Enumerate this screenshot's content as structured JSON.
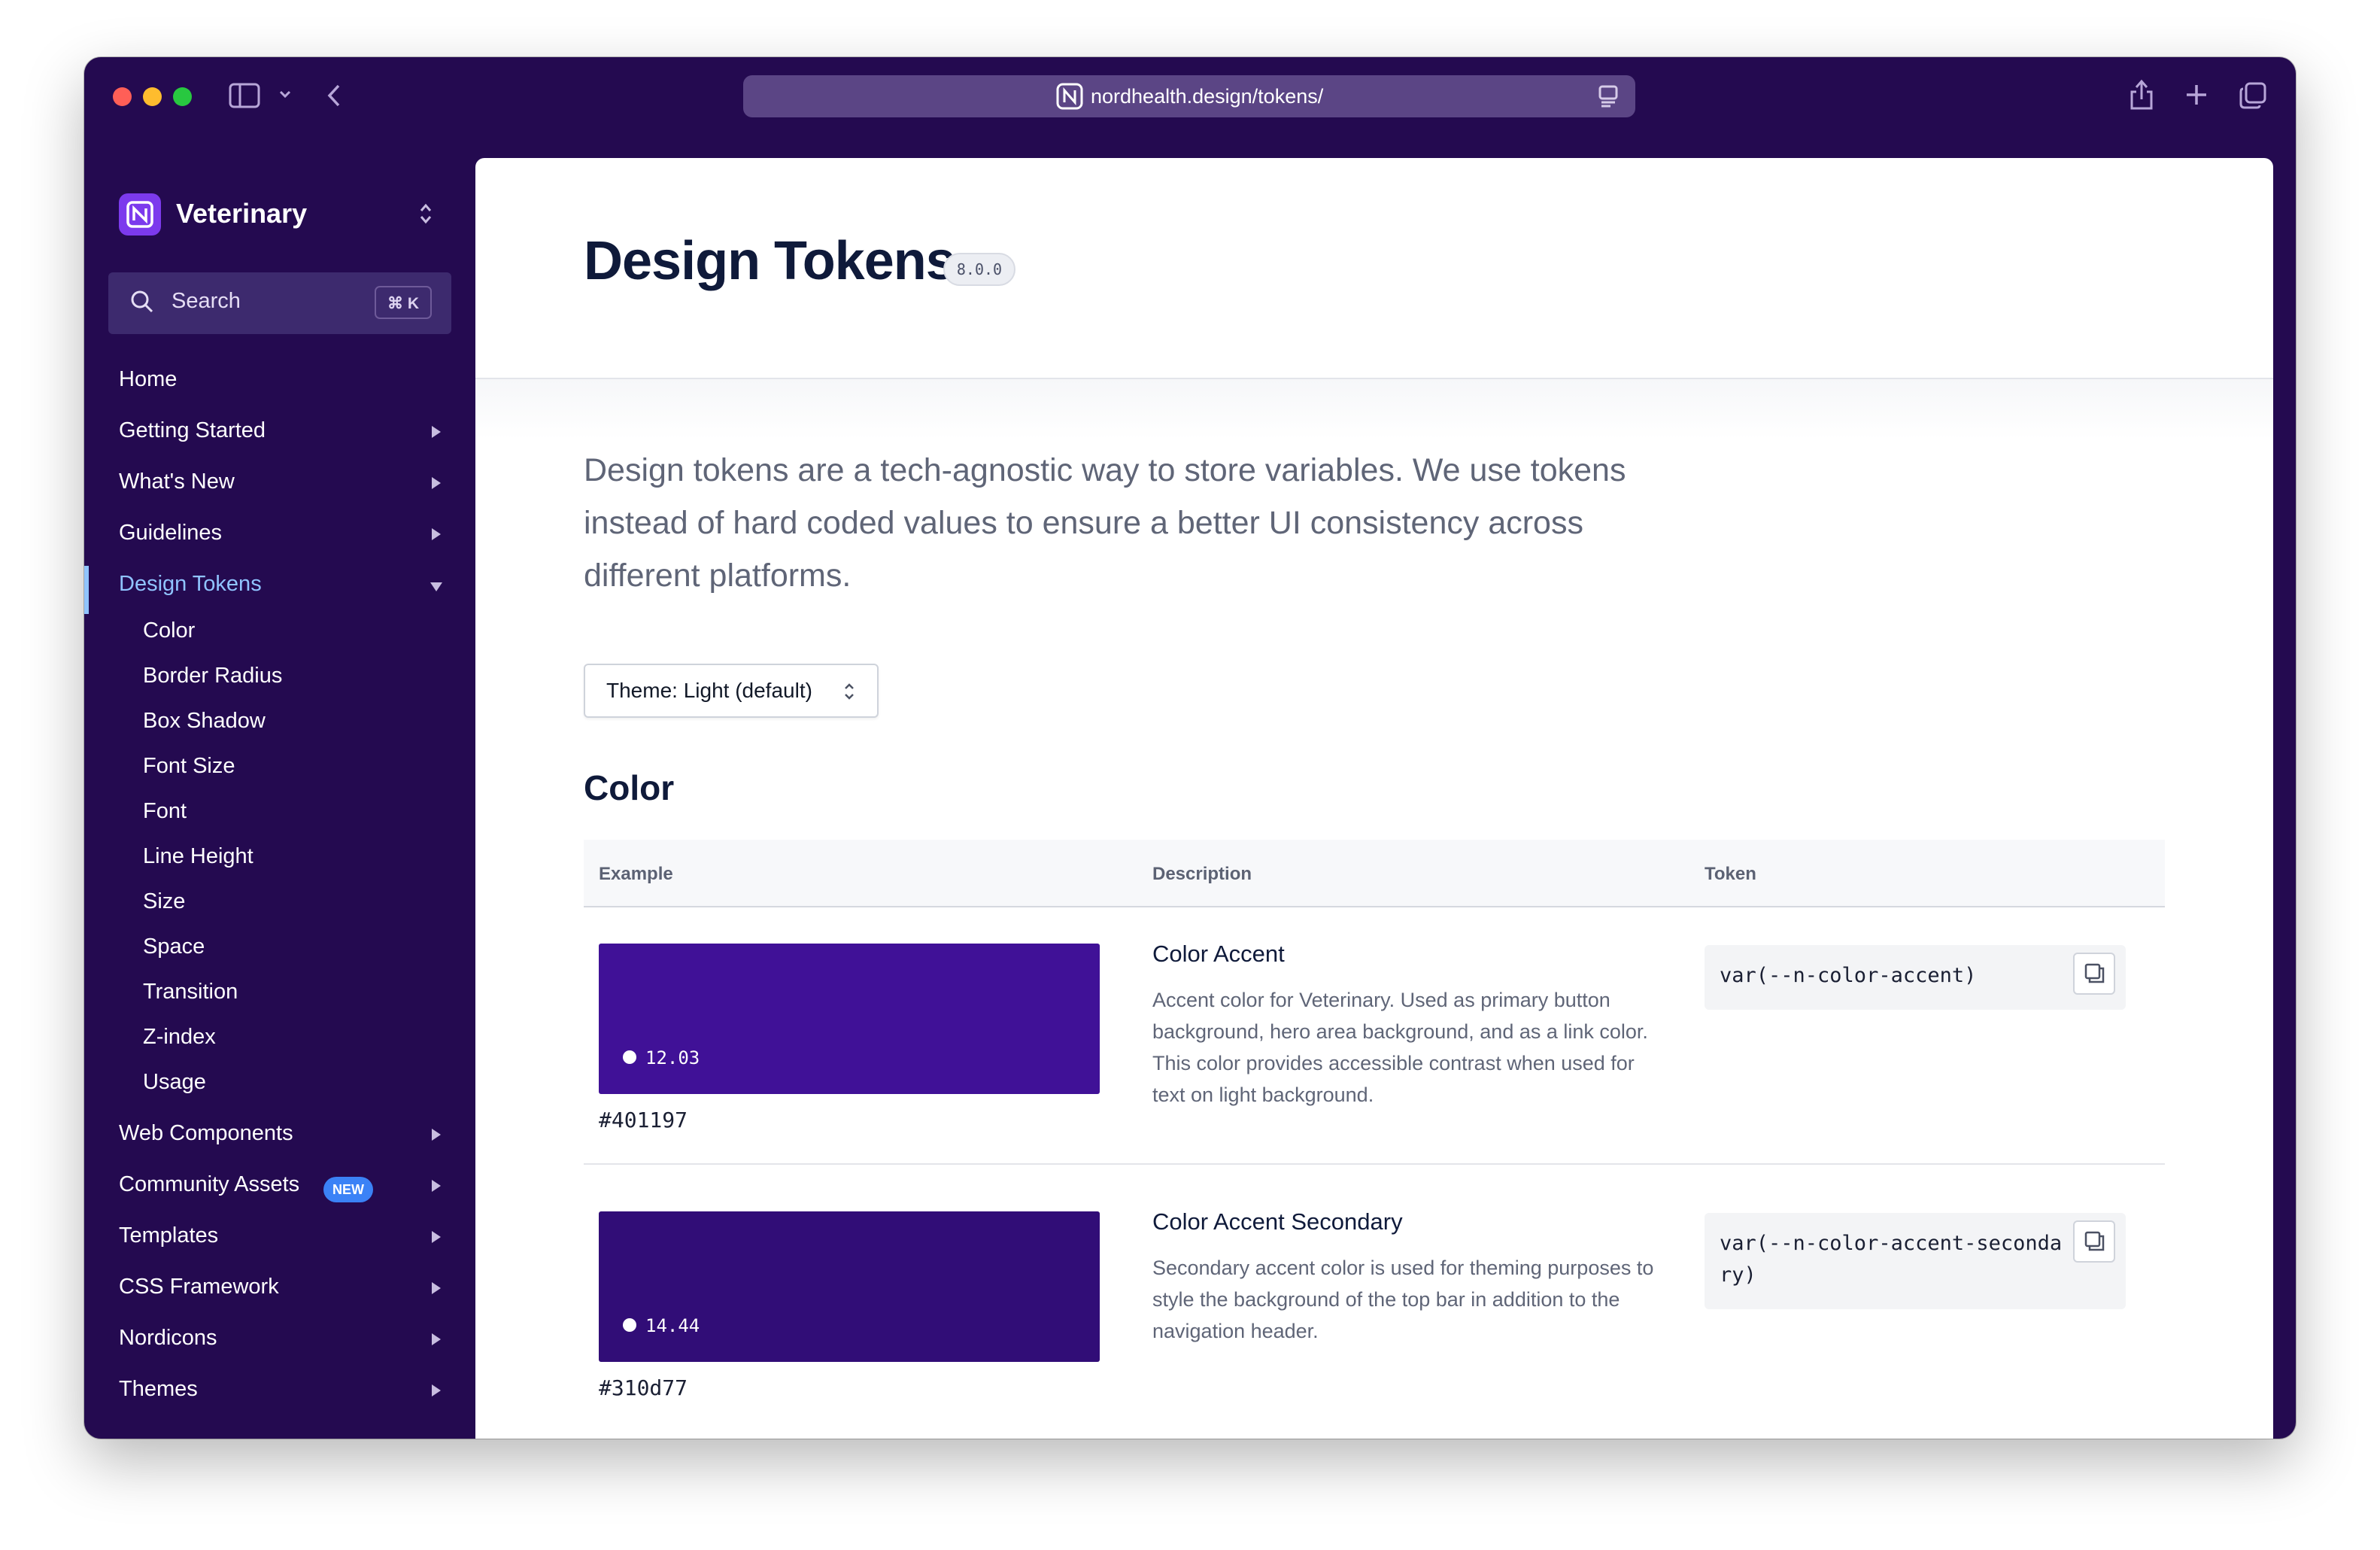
{
  "browser": {
    "url": "nordhealth.design/tokens/"
  },
  "sidebar": {
    "brand": "Veterinary",
    "search_label": "Search",
    "search_shortcut": "⌘ K",
    "items": [
      {
        "label": "Home",
        "expandable": false
      },
      {
        "label": "Getting Started",
        "expandable": true
      },
      {
        "label": "What's New",
        "expandable": true
      },
      {
        "label": "Guidelines",
        "expandable": true
      },
      {
        "label": "Design Tokens",
        "expandable": true,
        "active": true
      },
      {
        "label": "Web Components",
        "expandable": true
      },
      {
        "label": "Community Assets",
        "expandable": true,
        "badge": "NEW"
      },
      {
        "label": "Templates",
        "expandable": true
      },
      {
        "label": "CSS Framework",
        "expandable": true
      },
      {
        "label": "Nordicons",
        "expandable": true
      },
      {
        "label": "Themes",
        "expandable": true
      }
    ],
    "subitems": [
      "Color",
      "Border Radius",
      "Box Shadow",
      "Font Size",
      "Font",
      "Line Height",
      "Size",
      "Space",
      "Transition",
      "Z-index",
      "Usage"
    ]
  },
  "main": {
    "title": "Design Tokens",
    "version": "8.0.0",
    "lead": "Design tokens are a tech-agnostic way to store variables. We use tokens instead of hard coded values to ensure a better UI consistency across different platforms.",
    "theme_select": "Theme: Light (default)",
    "section_title": "Color",
    "table": {
      "headers": [
        "Example",
        "Description",
        "Token"
      ],
      "rows": [
        {
          "swatch_color": "#401197",
          "contrast": "12.03",
          "hex": "#401197",
          "name": "Color Accent",
          "description": "Accent color for Veterinary. Used as primary button background, hero area background, and as a link color. This color provides accessible contrast when used for text on light background.",
          "token": "var(--n-color-accent)"
        },
        {
          "swatch_color": "#310d77",
          "contrast": "14.44",
          "hex": "#310d77",
          "name": "Color Accent Secondary",
          "description": "Secondary accent color is used for theming purposes to style the background of the top bar in addition to the navigation header.",
          "token": "var(--n-color-accent-secondary)"
        }
      ]
    }
  },
  "colors": {
    "window_bg": "#240a50",
    "url_bar": "#5b4585",
    "active_nav": "#90c4ff",
    "badge_blue": "#3b82f6",
    "brand_logo": "#7c3aed"
  }
}
